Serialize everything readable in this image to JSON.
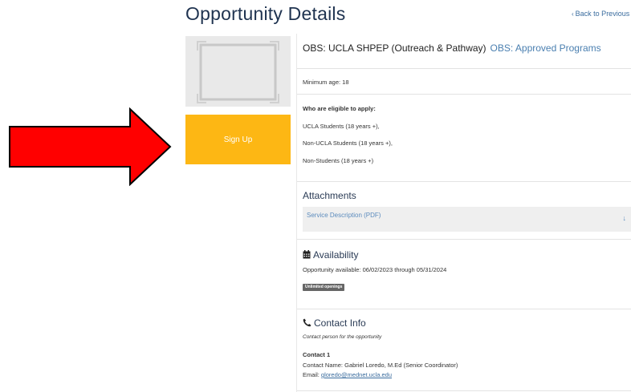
{
  "header": {
    "title": "Opportunity Details",
    "back_label": "Back to Previous"
  },
  "actions": {
    "signup_label": "Sign Up"
  },
  "opportunity": {
    "title": "OBS: UCLA SHPEP (Outreach & Pathway)",
    "program_link": "OBS: Approved Programs",
    "minimum_age": "Minimum age: 18",
    "eligibility_heading": "Who are eligible to apply:",
    "eligibility": [
      "UCLA Students (18 years +),",
      "Non-UCLA Students (18 years +),",
      "Non-Students (18 years +)"
    ]
  },
  "attachments": {
    "heading": "Attachments",
    "items": [
      {
        "label": "Service Description (PDF)"
      }
    ]
  },
  "availability": {
    "heading": "Availability",
    "text": "Opportunity available: 06/02/2023 through 05/31/2024",
    "badge": "Unlimited openings"
  },
  "contact": {
    "heading": "Contact Info",
    "subtitle": "Contact person for the opportunity",
    "label": "Contact 1",
    "name_line": "Contact Name: Gabriel Loredo, M.Ed (Senior Coordinator)",
    "email_label": "Email: ",
    "email": "gloredo@mednet.ucla.edu"
  },
  "colors": {
    "signup_button": "#fdb714",
    "annotation_arrow": "#ff0000",
    "link": "#4a7fb0",
    "title": "#1f3350"
  },
  "icons": {
    "back": "chevron-left-icon",
    "download": "download-arrow-icon",
    "availability": "calendar-icon",
    "contact": "phone-icon"
  }
}
